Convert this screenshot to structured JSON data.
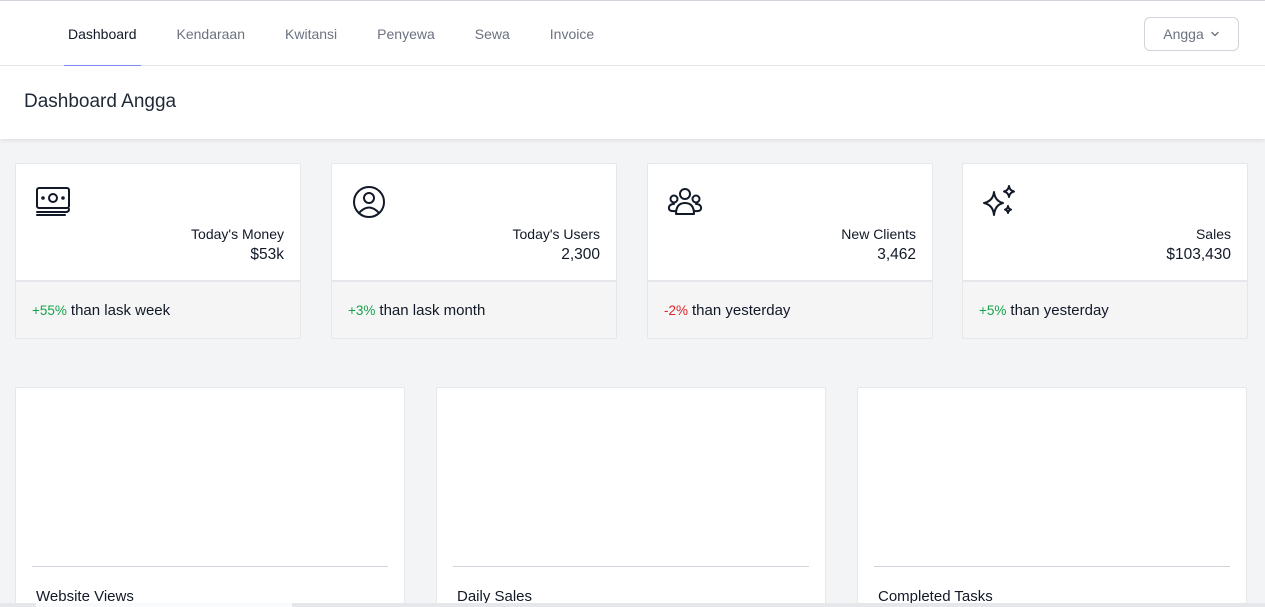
{
  "nav": {
    "items": [
      {
        "label": "Dashboard"
      },
      {
        "label": "Kendaraan"
      },
      {
        "label": "Kwitansi"
      },
      {
        "label": "Penyewa"
      },
      {
        "label": "Sewa"
      },
      {
        "label": "Invoice"
      }
    ],
    "active": "Dashboard",
    "user": {
      "label": "Angga"
    }
  },
  "header": {
    "title": "Dashboard Angga"
  },
  "stats": [
    {
      "icon": "money-icon",
      "label": "Today's Money",
      "value": "$53k",
      "delta": "+55%",
      "delta_color": "#16a34a",
      "footer": "than lask week"
    },
    {
      "icon": "user-circle-icon",
      "label": "Today's Users",
      "value": "2,300",
      "delta": "+3%",
      "delta_color": "#16a34a",
      "footer": "than lask month"
    },
    {
      "icon": "user-group-icon",
      "label": "New Clients",
      "value": "3,462",
      "delta": "-2%",
      "delta_color": "#dc2626",
      "footer": "than yesterday"
    },
    {
      "icon": "sparkles-icon",
      "label": "Sales",
      "value": "$103,430",
      "delta": "+5%",
      "delta_color": "#16a34a",
      "footer": "than yesterday"
    }
  ],
  "charts": [
    {
      "title": "Website Views"
    },
    {
      "title": "Daily Sales"
    },
    {
      "title": "Completed Tasks"
    }
  ],
  "colors": {
    "accent": "#818cf8",
    "positive": "#16a34a",
    "negative": "#dc2626"
  }
}
